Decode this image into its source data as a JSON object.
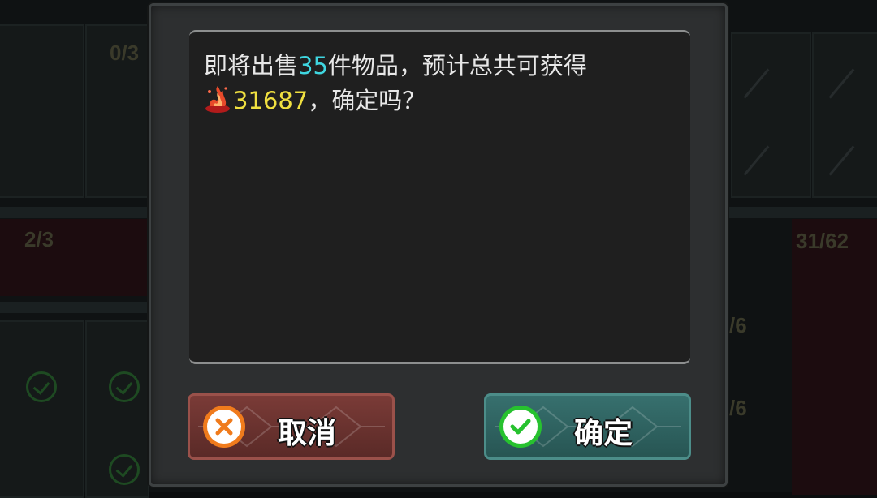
{
  "background": {
    "counts": [
      "0/3",
      "2/3",
      "31/62",
      "/6",
      "/6"
    ]
  },
  "dialog": {
    "message": {
      "part1": "即将出售",
      "item_count": "35",
      "part2": "件物品，预计总共可获得",
      "currency_icon": "flame-coin-icon",
      "amount": "31687",
      "part3": "，确定吗？"
    },
    "cancel_label": "取消",
    "confirm_label": "确定"
  },
  "colors": {
    "item_count": "#3fd6e0",
    "amount": "#f0e040",
    "cancel_button": "#6e3431",
    "confirm_button": "#326664"
  }
}
